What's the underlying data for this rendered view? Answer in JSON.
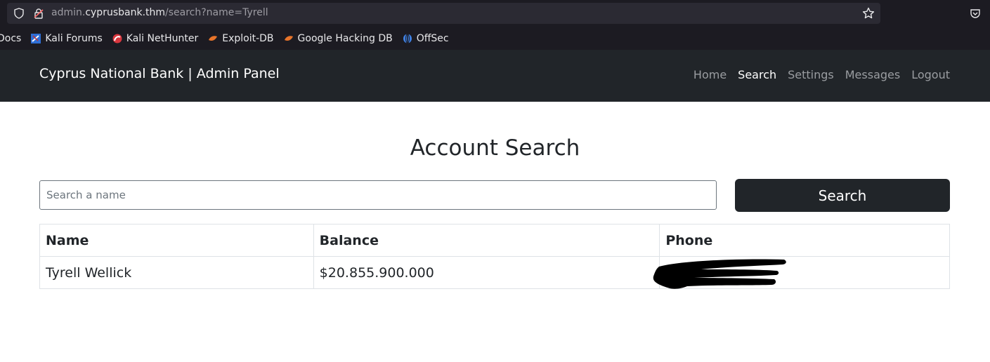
{
  "browser": {
    "url_prefix": "admin.",
    "url_host": "cyprusbank.thm",
    "url_path": "/search?name=Tyrell",
    "bookmarks": [
      {
        "label": "Docs",
        "icon": "none"
      },
      {
        "label": "Kali Forums",
        "icon": "kali-forums-icon"
      },
      {
        "label": "Kali NetHunter",
        "icon": "kali-nethunter-icon"
      },
      {
        "label": "Exploit-DB",
        "icon": "exploit-db-icon"
      },
      {
        "label": "Google Hacking DB",
        "icon": "ghdb-icon"
      },
      {
        "label": "OffSec",
        "icon": "offsec-icon"
      }
    ]
  },
  "navbar": {
    "brand": "Cyprus National Bank | Admin Panel",
    "links": [
      {
        "label": "Home",
        "active": false
      },
      {
        "label": "Search",
        "active": true
      },
      {
        "label": "Settings",
        "active": false
      },
      {
        "label": "Messages",
        "active": false
      },
      {
        "label": "Logout",
        "active": false
      }
    ]
  },
  "main": {
    "title": "Account Search",
    "search": {
      "placeholder": "Search a name",
      "value": "",
      "button_label": "Search"
    },
    "table": {
      "headers": [
        "Name",
        "Balance",
        "Phone"
      ],
      "rows": [
        {
          "name": "Tyrell Wellick",
          "balance": "$20.855.900.000",
          "phone": ""
        }
      ]
    }
  },
  "colors": {
    "navbar_bg": "#212529",
    "button_bg": "#212529",
    "chrome_bg": "#1c1b22"
  }
}
